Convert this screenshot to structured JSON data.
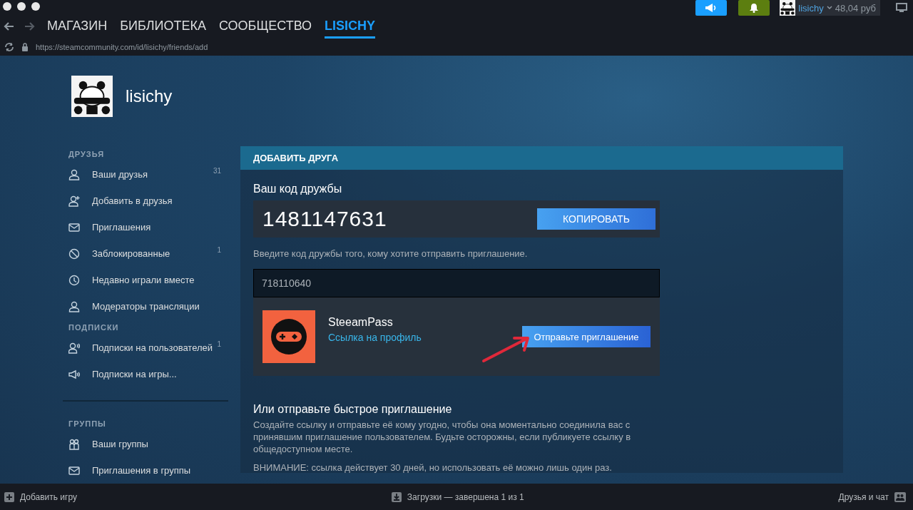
{
  "nav": {
    "items": [
      {
        "label": "МАГАЗИН",
        "selected": false
      },
      {
        "label": "БИБЛИОТЕКА",
        "selected": false
      },
      {
        "label": "СООБЩЕСТВО",
        "selected": false
      },
      {
        "label": "LISICHY",
        "selected": true
      }
    ],
    "url": "https://steamcommunity.com/id/lisichy/friends/add"
  },
  "account": {
    "username": "lisichy",
    "balance": "48,04 руб"
  },
  "profile": {
    "name": "lisichy"
  },
  "sidebar": {
    "sections": [
      {
        "title": "ДРУЗЬЯ",
        "items": [
          {
            "label": "Ваши друзья",
            "count": "31"
          },
          {
            "label": "Добавить в друзья"
          },
          {
            "label": "Приглашения"
          },
          {
            "label": "Заблокированные",
            "count": "1"
          },
          {
            "label": "Недавно играли вместе"
          },
          {
            "label": "Модераторы трансляции"
          }
        ]
      },
      {
        "title": "ПОДПИСКИ",
        "items": [
          {
            "label": "Подписки на пользователей",
            "count": "1"
          },
          {
            "label": "Подписки на игры..."
          }
        ]
      },
      {
        "title": "ГРУППЫ",
        "divider": true,
        "items": [
          {
            "label": "Ваши группы"
          },
          {
            "label": "Приглашения в группы"
          }
        ]
      }
    ]
  },
  "panel": {
    "header": "ДОБАВИТЬ ДРУГА",
    "code_label": "Ваш код дружбы",
    "code": "1481147631",
    "copy_button": "КОПИРОВАТЬ",
    "hint": "Введите код дружбы того, кому хотите отправить приглашение.",
    "input": {
      "value": "718110640"
    },
    "result": {
      "name": "SteeamPass",
      "link": "Ссылка на профиль",
      "button": "Отправьте приглашение"
    },
    "quick_title": "Или отправьте быстрое приглашение",
    "quick_text": "Создайте ссылку и отправьте её кому угодно, чтобы она моментально соединила вас с принявшим приглашение пользователем. Будьте осторожны, если публикуете ссылку в общедоступном месте.",
    "warning": "ВНИМАНИЕ: ссылка действует 30 дней, но использовать её можно лишь один раз."
  },
  "footer": {
    "add_game": "Добавить игру",
    "downloads": "Загрузки — завершена 1 из 1",
    "friends": "Друзья и чат"
  }
}
